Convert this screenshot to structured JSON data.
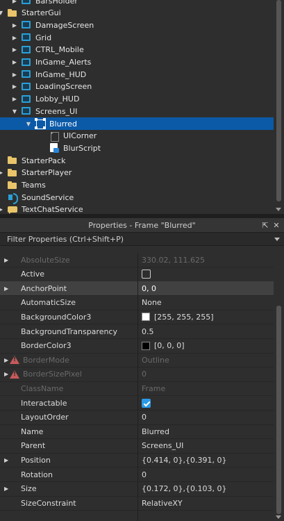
{
  "explorer": {
    "items": [
      {
        "label": "BarsHolder",
        "indent": 30,
        "icon": "screen-gui-icon",
        "arrow": "collapsed"
      },
      {
        "label": "StarterGui",
        "indent": 10,
        "icon": "folder-icon",
        "arrow": "expanded"
      },
      {
        "label": "DamageScreen",
        "indent": 30,
        "icon": "screen-gui-icon",
        "arrow": "collapsed"
      },
      {
        "label": "Grid",
        "indent": 30,
        "icon": "screen-gui-icon",
        "arrow": "collapsed"
      },
      {
        "label": "CTRL_Mobile",
        "indent": 30,
        "icon": "screen-gui-icon",
        "arrow": "collapsed"
      },
      {
        "label": "InGame_Alerts",
        "indent": 30,
        "icon": "screen-gui-icon",
        "arrow": "collapsed"
      },
      {
        "label": "InGame_HUD",
        "indent": 30,
        "icon": "screen-gui-icon",
        "arrow": "collapsed"
      },
      {
        "label": "LoadingScreen",
        "indent": 30,
        "icon": "screen-gui-icon",
        "arrow": "collapsed"
      },
      {
        "label": "Lobby_HUD",
        "indent": 30,
        "icon": "screen-gui-icon",
        "arrow": "collapsed"
      },
      {
        "label": "Screens_UI",
        "indent": 30,
        "icon": "screen-gui-icon",
        "arrow": "expanded"
      },
      {
        "label": "Blurred",
        "indent": 50,
        "icon": "frame-icon",
        "arrow": "expanded",
        "selected": true
      },
      {
        "label": "UICorner",
        "indent": 70,
        "icon": "ui-corner-icon",
        "arrow": "none"
      },
      {
        "label": "BlurScript",
        "indent": 70,
        "icon": "script-icon",
        "arrow": "none"
      },
      {
        "label": "StarterPack",
        "indent": 10,
        "icon": "folder-icon",
        "arrow": "none"
      },
      {
        "label": "StarterPlayer",
        "indent": 10,
        "icon": "folder-icon",
        "arrow": "collapsed"
      },
      {
        "label": "Teams",
        "indent": 10,
        "icon": "folder-icon",
        "arrow": "none"
      },
      {
        "label": "SoundService",
        "indent": 10,
        "icon": "sound-icon",
        "arrow": "none"
      },
      {
        "label": "TextChatService",
        "indent": 10,
        "icon": "chat-icon",
        "arrow": "collapsed"
      }
    ]
  },
  "properties": {
    "title": "Properties - Frame \"Blurred\"",
    "filter_placeholder": "Filter Properties (Ctrl+Shift+P)",
    "rows": [
      {
        "name": "AbsoluteSize",
        "value": "330.02, 111.625",
        "dim": true,
        "arrow": true
      },
      {
        "name": "Active",
        "value": "",
        "checkbox": "unchecked"
      },
      {
        "name": "AnchorPoint",
        "value": "0, 0",
        "arrow": true,
        "highlight": true
      },
      {
        "name": "AutomaticSize",
        "value": "None"
      },
      {
        "name": "BackgroundColor3",
        "value": "[255, 255, 255]",
        "swatch": "#ffffff"
      },
      {
        "name": "BackgroundTransparency",
        "value": "0.5"
      },
      {
        "name": "BorderColor3",
        "value": "[0, 0, 0]",
        "swatch": "#000000"
      },
      {
        "name": "BorderMode",
        "value": "Outline",
        "dim": true,
        "arrow": true,
        "warn": true
      },
      {
        "name": "BorderSizePixel",
        "value": "0",
        "dim": true,
        "arrow": true,
        "warn": true
      },
      {
        "name": "ClassName",
        "value": "Frame",
        "dim": true
      },
      {
        "name": "Interactable",
        "value": "",
        "checkbox": "checked"
      },
      {
        "name": "LayoutOrder",
        "value": "0"
      },
      {
        "name": "Name",
        "value": "Blurred"
      },
      {
        "name": "Parent",
        "value": "Screens_UI"
      },
      {
        "name": "Position",
        "value": "{0.414, 0},{0.391, 0}",
        "arrow": true
      },
      {
        "name": "Rotation",
        "value": "0"
      },
      {
        "name": "Size",
        "value": "{0.172, 0},{0.103, 0}",
        "arrow": true
      },
      {
        "name": "SizeConstraint",
        "value": "RelativeXY"
      }
    ]
  }
}
